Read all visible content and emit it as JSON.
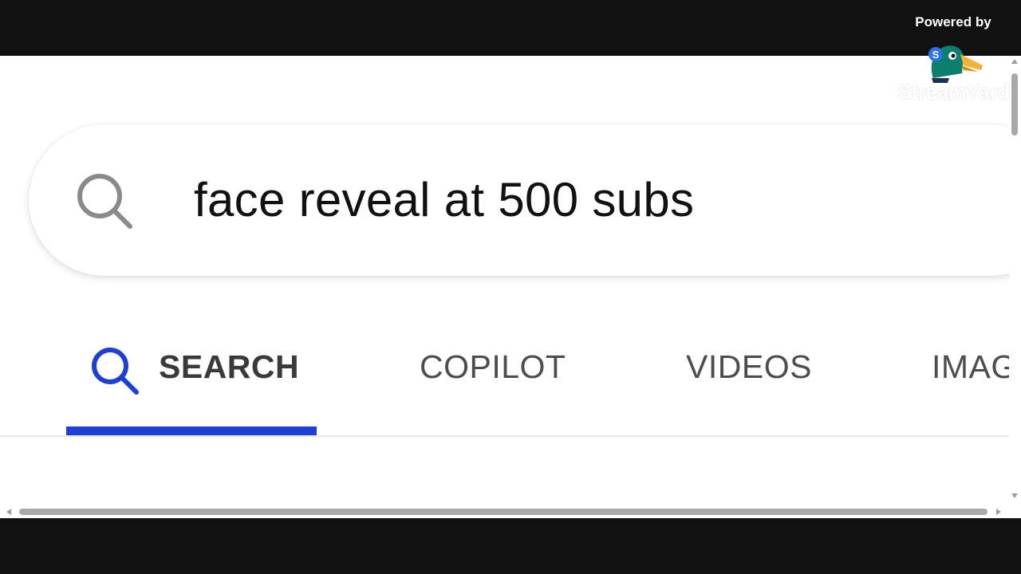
{
  "search": {
    "query": "face reveal at 500 subs"
  },
  "tabs": [
    {
      "label": "SEARCH",
      "active": true
    },
    {
      "label": "COPILOT",
      "active": false
    },
    {
      "label": "VIDEOS",
      "active": false
    },
    {
      "label": "IMAG",
      "active": false
    }
  ],
  "watermark": {
    "powered_by": "Powered by",
    "brand": "StreamYard",
    "logo_letter": "S"
  },
  "colors": {
    "accent": "#1d3fd6",
    "search_icon_gray": "#8a8a8a",
    "tab_text": "#4d4d4d",
    "letterbox": "#111111"
  }
}
